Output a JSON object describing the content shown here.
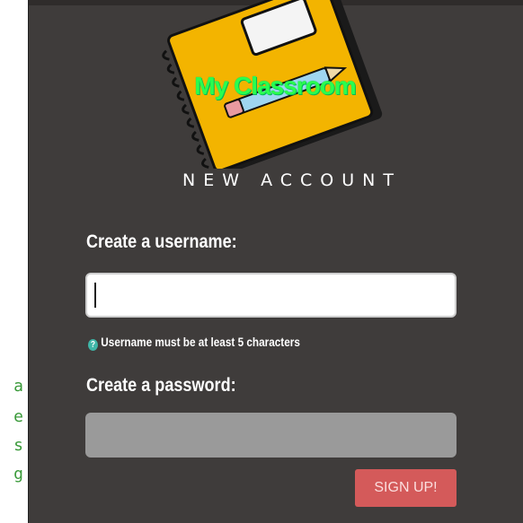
{
  "side_text": [
    "a",
    "e",
    "s",
    "g"
  ],
  "logo": {
    "title": "My Classroom"
  },
  "form": {
    "heading": "NEW ACCOUNT",
    "username_label": "Create a username:",
    "username_value": "",
    "username_hint": "Username must be at least 5 characters",
    "password_label": "Create a password:",
    "password_value": "",
    "submit_label": "SIGN UP!"
  },
  "colors": {
    "panel": "#3f3c3b",
    "submit_button": "#d45a5a",
    "hint_icon": "#3fb6a8",
    "logo_title": "#2aff4e"
  },
  "icons": {
    "hint": "info-icon",
    "logo": "notebook-icon"
  }
}
